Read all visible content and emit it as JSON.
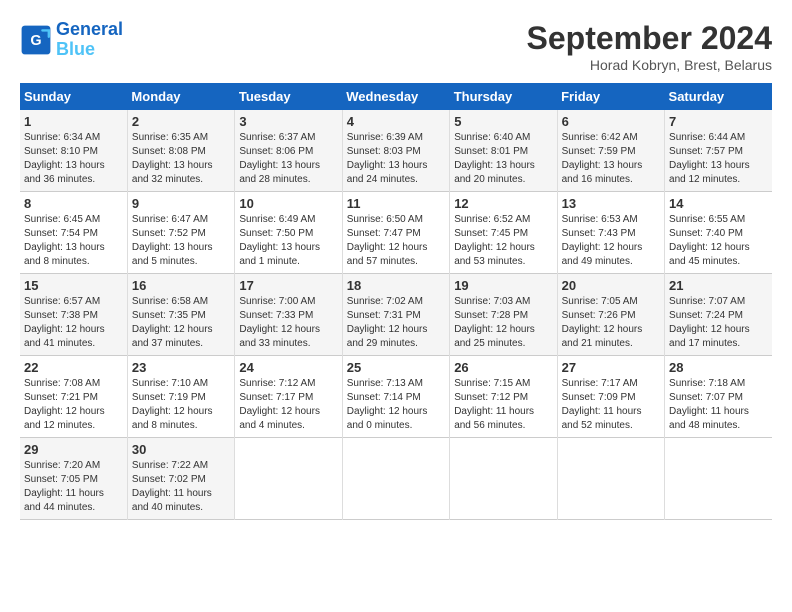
{
  "header": {
    "logo_line1": "General",
    "logo_line2": "Blue",
    "month": "September 2024",
    "location": "Horad Kobryn, Brest, Belarus"
  },
  "days_of_week": [
    "Sunday",
    "Monday",
    "Tuesday",
    "Wednesday",
    "Thursday",
    "Friday",
    "Saturday"
  ],
  "weeks": [
    [
      {
        "day": "1",
        "detail": "Sunrise: 6:34 AM\nSunset: 8:10 PM\nDaylight: 13 hours\nand 36 minutes."
      },
      {
        "day": "2",
        "detail": "Sunrise: 6:35 AM\nSunset: 8:08 PM\nDaylight: 13 hours\nand 32 minutes."
      },
      {
        "day": "3",
        "detail": "Sunrise: 6:37 AM\nSunset: 8:06 PM\nDaylight: 13 hours\nand 28 minutes."
      },
      {
        "day": "4",
        "detail": "Sunrise: 6:39 AM\nSunset: 8:03 PM\nDaylight: 13 hours\nand 24 minutes."
      },
      {
        "day": "5",
        "detail": "Sunrise: 6:40 AM\nSunset: 8:01 PM\nDaylight: 13 hours\nand 20 minutes."
      },
      {
        "day": "6",
        "detail": "Sunrise: 6:42 AM\nSunset: 7:59 PM\nDaylight: 13 hours\nand 16 minutes."
      },
      {
        "day": "7",
        "detail": "Sunrise: 6:44 AM\nSunset: 7:57 PM\nDaylight: 13 hours\nand 12 minutes."
      }
    ],
    [
      {
        "day": "8",
        "detail": "Sunrise: 6:45 AM\nSunset: 7:54 PM\nDaylight: 13 hours\nand 8 minutes."
      },
      {
        "day": "9",
        "detail": "Sunrise: 6:47 AM\nSunset: 7:52 PM\nDaylight: 13 hours\nand 5 minutes."
      },
      {
        "day": "10",
        "detail": "Sunrise: 6:49 AM\nSunset: 7:50 PM\nDaylight: 13 hours\nand 1 minute."
      },
      {
        "day": "11",
        "detail": "Sunrise: 6:50 AM\nSunset: 7:47 PM\nDaylight: 12 hours\nand 57 minutes."
      },
      {
        "day": "12",
        "detail": "Sunrise: 6:52 AM\nSunset: 7:45 PM\nDaylight: 12 hours\nand 53 minutes."
      },
      {
        "day": "13",
        "detail": "Sunrise: 6:53 AM\nSunset: 7:43 PM\nDaylight: 12 hours\nand 49 minutes."
      },
      {
        "day": "14",
        "detail": "Sunrise: 6:55 AM\nSunset: 7:40 PM\nDaylight: 12 hours\nand 45 minutes."
      }
    ],
    [
      {
        "day": "15",
        "detail": "Sunrise: 6:57 AM\nSunset: 7:38 PM\nDaylight: 12 hours\nand 41 minutes."
      },
      {
        "day": "16",
        "detail": "Sunrise: 6:58 AM\nSunset: 7:35 PM\nDaylight: 12 hours\nand 37 minutes."
      },
      {
        "day": "17",
        "detail": "Sunrise: 7:00 AM\nSunset: 7:33 PM\nDaylight: 12 hours\nand 33 minutes."
      },
      {
        "day": "18",
        "detail": "Sunrise: 7:02 AM\nSunset: 7:31 PM\nDaylight: 12 hours\nand 29 minutes."
      },
      {
        "day": "19",
        "detail": "Sunrise: 7:03 AM\nSunset: 7:28 PM\nDaylight: 12 hours\nand 25 minutes."
      },
      {
        "day": "20",
        "detail": "Sunrise: 7:05 AM\nSunset: 7:26 PM\nDaylight: 12 hours\nand 21 minutes."
      },
      {
        "day": "21",
        "detail": "Sunrise: 7:07 AM\nSunset: 7:24 PM\nDaylight: 12 hours\nand 17 minutes."
      }
    ],
    [
      {
        "day": "22",
        "detail": "Sunrise: 7:08 AM\nSunset: 7:21 PM\nDaylight: 12 hours\nand 12 minutes."
      },
      {
        "day": "23",
        "detail": "Sunrise: 7:10 AM\nSunset: 7:19 PM\nDaylight: 12 hours\nand 8 minutes."
      },
      {
        "day": "24",
        "detail": "Sunrise: 7:12 AM\nSunset: 7:17 PM\nDaylight: 12 hours\nand 4 minutes."
      },
      {
        "day": "25",
        "detail": "Sunrise: 7:13 AM\nSunset: 7:14 PM\nDaylight: 12 hours\nand 0 minutes."
      },
      {
        "day": "26",
        "detail": "Sunrise: 7:15 AM\nSunset: 7:12 PM\nDaylight: 11 hours\nand 56 minutes."
      },
      {
        "day": "27",
        "detail": "Sunrise: 7:17 AM\nSunset: 7:09 PM\nDaylight: 11 hours\nand 52 minutes."
      },
      {
        "day": "28",
        "detail": "Sunrise: 7:18 AM\nSunset: 7:07 PM\nDaylight: 11 hours\nand 48 minutes."
      }
    ],
    [
      {
        "day": "29",
        "detail": "Sunrise: 7:20 AM\nSunset: 7:05 PM\nDaylight: 11 hours\nand 44 minutes."
      },
      {
        "day": "30",
        "detail": "Sunrise: 7:22 AM\nSunset: 7:02 PM\nDaylight: 11 hours\nand 40 minutes."
      },
      null,
      null,
      null,
      null,
      null
    ]
  ]
}
